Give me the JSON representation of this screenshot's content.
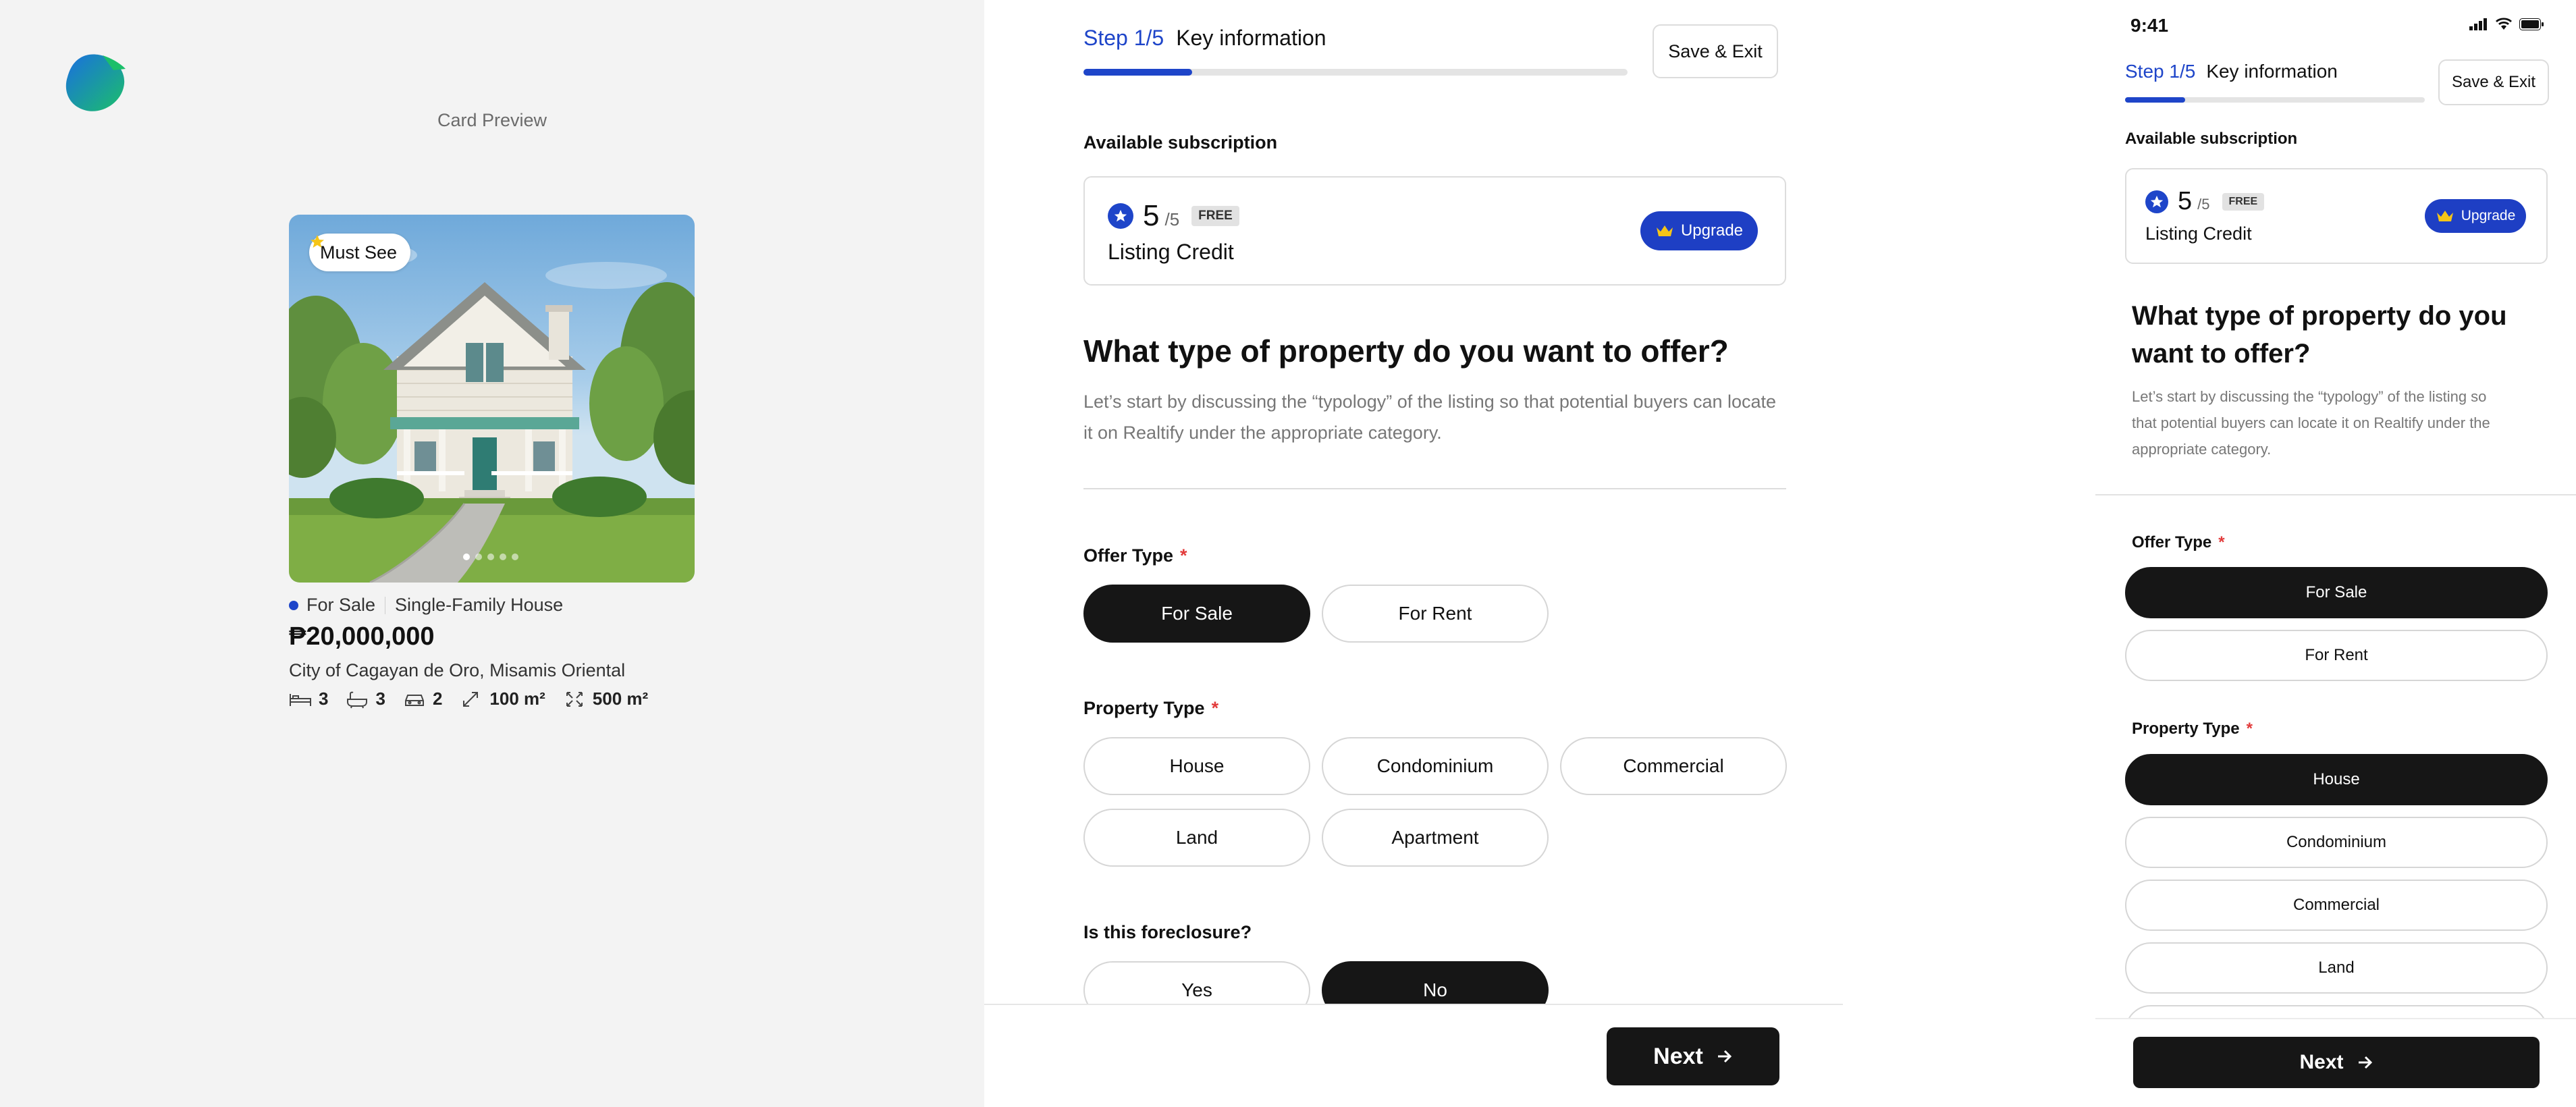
{
  "colors": {
    "accent": "#1e45c9",
    "upgrade": "#1e3fc4",
    "selected_pill": "#161616",
    "required": "#e23b3b",
    "preview_bg": "#f3f3f3",
    "must_see_star": "#f5c518",
    "crown": "#f5c518"
  },
  "preview": {
    "label": "Card Preview",
    "logo_icon": "app-logo-icon",
    "badge": "Must See",
    "badge_icon": "star-icon",
    "photo_slides": 5,
    "photo_active_slide": 1,
    "status": "For Sale",
    "property_type": "Single-Family House",
    "price": "₱20,000,000",
    "location": "City of Cagayan de Oro, Misamis Oriental",
    "specs": {
      "bedrooms": "3",
      "bathrooms": "3",
      "parking": "2",
      "floor_area": "100 m²",
      "lot_area": "500 m²"
    }
  },
  "desktop": {
    "step": "Step 1/5",
    "step_title": "Key information",
    "progress_fraction": 0.2,
    "save_exit": "Save & Exit",
    "subscription_heading": "Available subscription",
    "credit_count": "5",
    "credit_max": "/5",
    "free_tag": "FREE",
    "credit_label": "Listing Credit",
    "upgrade": "Upgrade",
    "question": "What type of property do you want to offer?",
    "description_line1": "Let’s start by discussing the “typology” of the listing so that potential buyers can locate",
    "description_line2": "it on Realtify under the appropriate category.",
    "offer_type_label": "Offer Type",
    "required_mark": "*",
    "offer_types": [
      "For Sale",
      "For Rent"
    ],
    "offer_type_selected": "For Sale",
    "property_type_label": "Property Type",
    "property_types": [
      "House",
      "Condominium",
      "Commercial",
      "Land",
      "Apartment"
    ],
    "foreclosure_label": "Is this foreclosure?",
    "foreclosure_options": [
      "Yes",
      "No"
    ],
    "foreclosure_selected": "No",
    "next": "Next"
  },
  "mobile": {
    "time": "9:41",
    "step": "Step 1/5",
    "step_title": "Key information",
    "progress_fraction": 0.2,
    "save_exit": "Save & Exit",
    "subscription_heading": "Available subscription",
    "credit_count": "5",
    "credit_max": "/5",
    "free_tag": "FREE",
    "credit_label": "Listing Credit",
    "upgrade": "Upgrade",
    "question_line1": "What type of property do you",
    "question_line2": "want to offer?",
    "description_line1": "Let’s start by discussing the “typology” of the listing so",
    "description_line2": "that potential buyers can locate it on Realtify under the",
    "description_line3": "appropriate category.",
    "offer_type_label": "Offer Type",
    "required_mark": "*",
    "offer_types": [
      "For Sale",
      "For Rent"
    ],
    "offer_type_selected": "For Sale",
    "property_type_label": "Property Type",
    "property_types": [
      "House",
      "Condominium",
      "Commercial",
      "Land"
    ],
    "property_type_selected": "House",
    "next": "Next"
  }
}
